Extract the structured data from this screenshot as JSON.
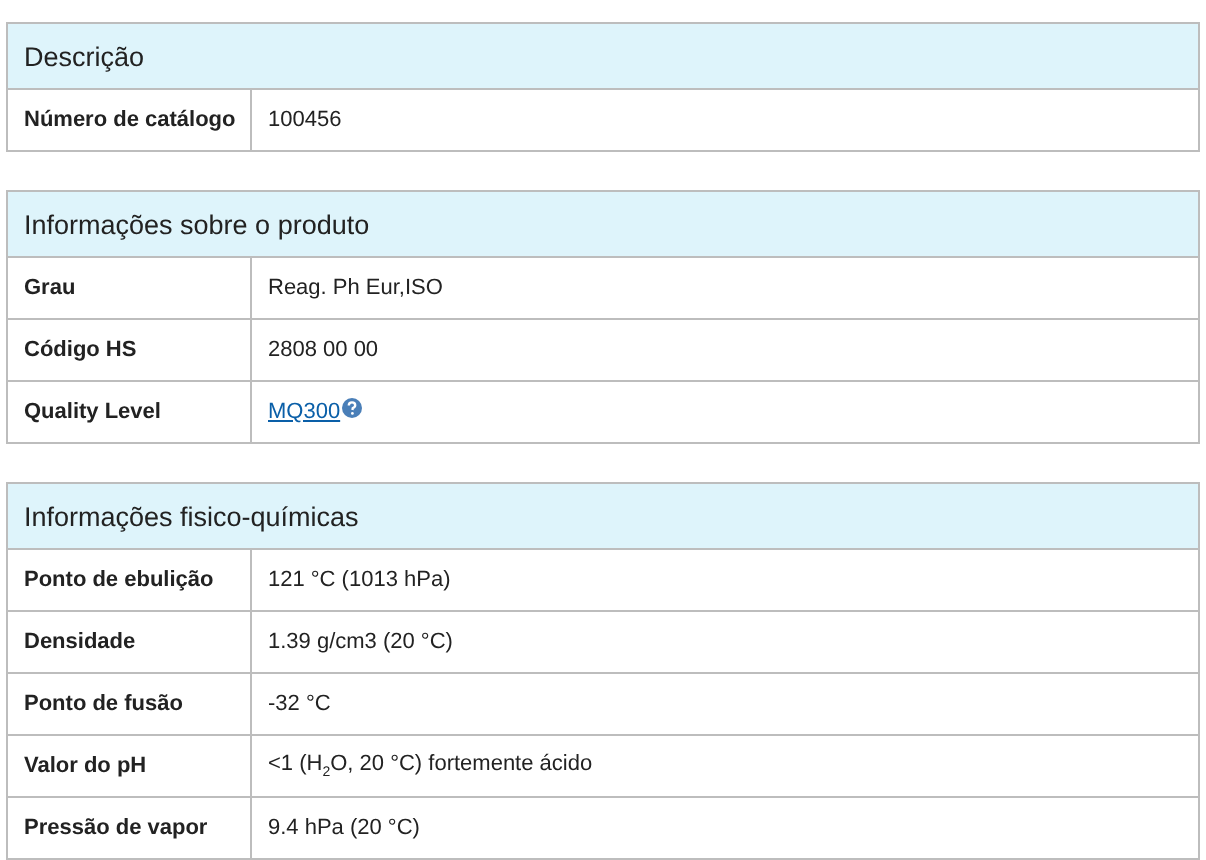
{
  "sections": [
    {
      "title": "Descrição",
      "rows": [
        {
          "label": "Número de catálogo",
          "value": "100456",
          "kind": "text"
        }
      ]
    },
    {
      "title": "Informações sobre o produto",
      "rows": [
        {
          "label": "Grau",
          "value": "Reag. Ph Eur,ISO",
          "kind": "text"
        },
        {
          "label": "Código HS",
          "value": "2808 00 00",
          "kind": "text"
        },
        {
          "label": "Quality Level",
          "value": "MQ300",
          "kind": "link"
        }
      ]
    },
    {
      "title": "Informações fisico-químicas",
      "rows": [
        {
          "label": "Ponto de ebulição",
          "value": "121 °C (1013 hPa)",
          "kind": "text"
        },
        {
          "label": "Densidade",
          "value": "1.39 g/cm3 (20 °C)",
          "kind": "text"
        },
        {
          "label": "Ponto de fusão",
          "value": "-32 °C",
          "kind": "text"
        },
        {
          "label": "Valor do pH",
          "value": "<1 (H$_{2}$O, 20 °C) fortemente ácido",
          "kind": "text"
        },
        {
          "label": "Pressão de vapor",
          "value": "9.4 hPa (20 °C)",
          "kind": "text"
        }
      ]
    }
  ]
}
